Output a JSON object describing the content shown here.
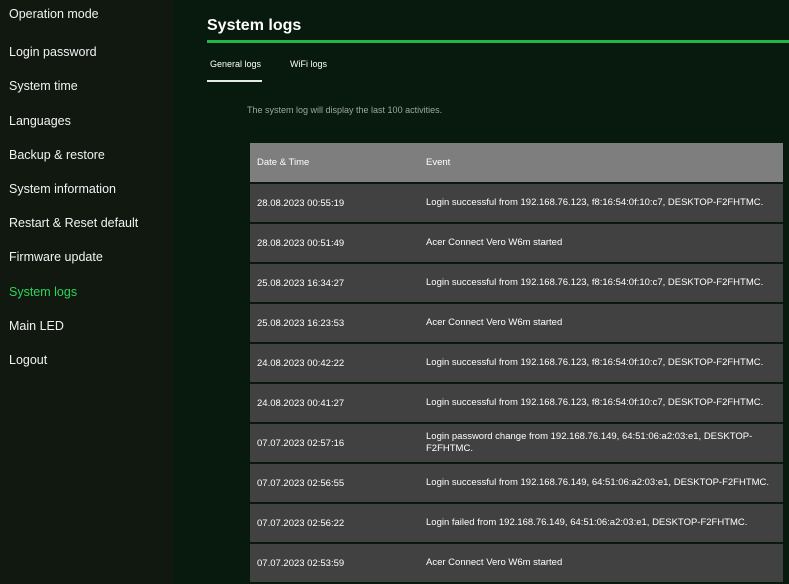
{
  "sidebar": {
    "items": [
      {
        "label": "Operation mode"
      },
      {
        "label": "Login password"
      },
      {
        "label": "System time"
      },
      {
        "label": "Languages"
      },
      {
        "label": "Backup & restore"
      },
      {
        "label": "System information"
      },
      {
        "label": "Restart & Reset default"
      },
      {
        "label": "Firmware update"
      },
      {
        "label": "System logs",
        "active": true
      },
      {
        "label": "Main LED"
      },
      {
        "label": "Logout"
      }
    ]
  },
  "main": {
    "title": "System logs",
    "tabs": [
      {
        "label": "General logs",
        "active": true
      },
      {
        "label": "WiFi logs"
      }
    ],
    "info_text": "The system log will display the last 100 activities.",
    "table": {
      "columns": [
        "Date & Time",
        "Event"
      ],
      "rows": [
        {
          "datetime": "28.08.2023 00:55:19",
          "event": "Login successful from 192.168.76.123, f8:16:54:0f:10:c7, DESKTOP-F2FHTMC."
        },
        {
          "datetime": "28.08.2023 00:51:49",
          "event": "Acer Connect Vero W6m started"
        },
        {
          "datetime": "25.08.2023 16:34:27",
          "event": "Login successful from 192.168.76.123, f8:16:54:0f:10:c7, DESKTOP-F2FHTMC."
        },
        {
          "datetime": "25.08.2023 16:23:53",
          "event": "Acer Connect Vero W6m started"
        },
        {
          "datetime": "24.08.2023 00:42:22",
          "event": "Login successful from 192.168.76.123, f8:16:54:0f:10:c7, DESKTOP-F2FHTMC."
        },
        {
          "datetime": "24.08.2023 00:41:27",
          "event": "Login successful from 192.168.76.123, f8:16:54:0f:10:c7, DESKTOP-F2FHTMC."
        },
        {
          "datetime": "07.07.2023 02:57:16",
          "event": "Login password change from 192.168.76.149, 64:51:06:a2:03:e1, DESKTOP-F2FHTMC."
        },
        {
          "datetime": "07.07.2023 02:56:55",
          "event": "Login successful from 192.168.76.149, 64:51:06:a2:03:e1, DESKTOP-F2FHTMC."
        },
        {
          "datetime": "07.07.2023 02:56:22",
          "event": "Login failed from 192.168.76.149, 64:51:06:a2:03:e1, DESKTOP-F2FHTMC."
        },
        {
          "datetime": "07.07.2023 02:53:59",
          "event": "Acer Connect Vero W6m started"
        }
      ]
    }
  },
  "colors": {
    "accent": "#2fd35a",
    "header_row": "#7e7e7e",
    "data_row": "#414141",
    "main_bg": "#071a0d",
    "sidebar_bg": "#101810"
  }
}
